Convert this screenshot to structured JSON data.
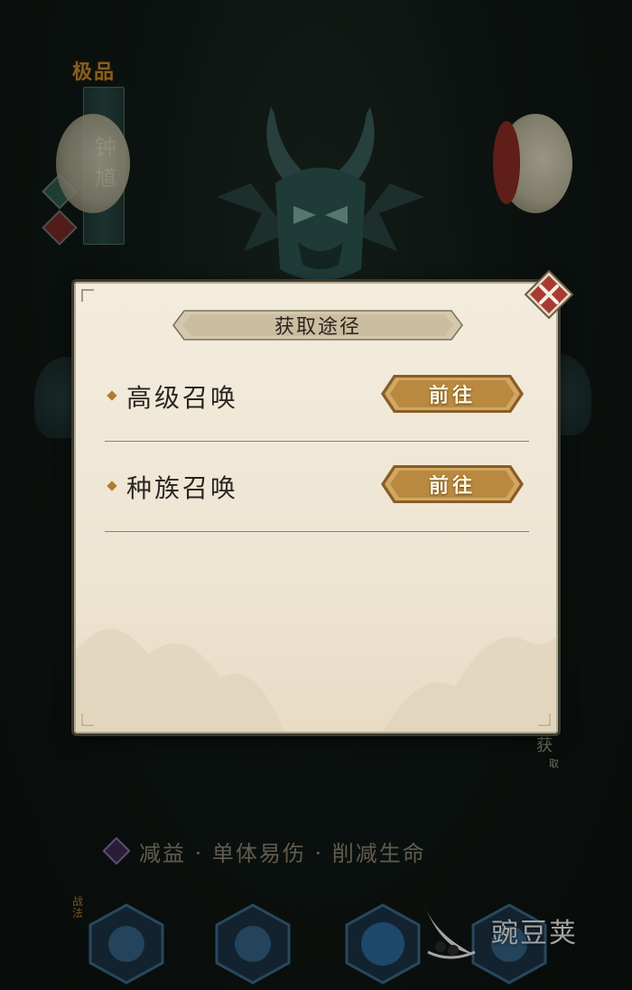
{
  "character": {
    "rarity": "极品",
    "name": "钟馗"
  },
  "modal": {
    "title": "获取途径",
    "options": [
      {
        "label": "高级召唤",
        "button": "前往"
      },
      {
        "label": "种族召唤",
        "button": "前往"
      }
    ]
  },
  "side_button": {
    "label_main": "获",
    "label_sub": "取"
  },
  "traits": {
    "text": "减益 · 单体易伤 · 削减生命"
  },
  "skills": {
    "label": "战法"
  },
  "watermark": {
    "text": "豌豆荚"
  },
  "colors": {
    "modal_bg": "#f0e8d8",
    "button_gold": "#c9a15c",
    "close_red": "#a83a33",
    "accent_orange": "#c98b2f"
  }
}
